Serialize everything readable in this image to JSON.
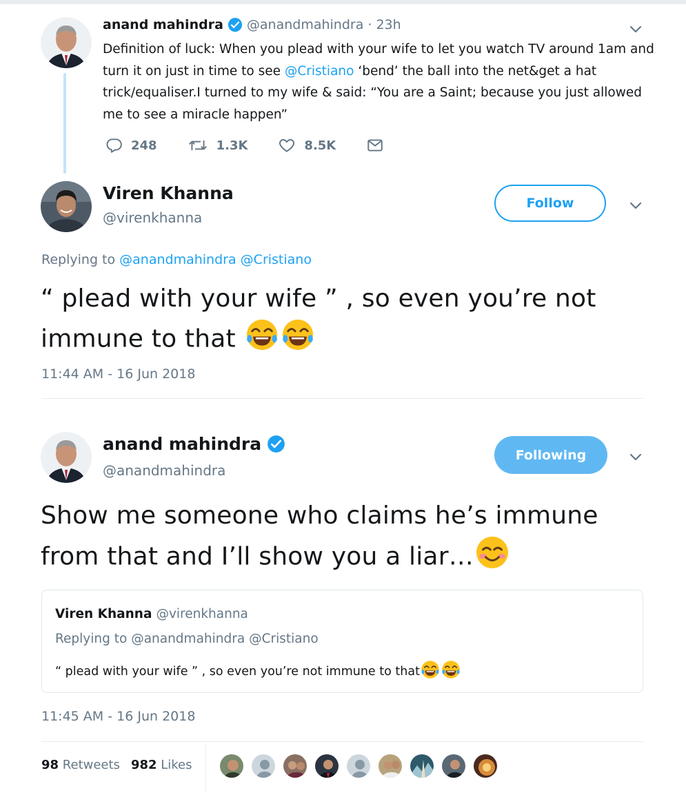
{
  "parent": {
    "name": "anand mahindra",
    "handle": "@anandmahindra",
    "time": "· 23h",
    "text_before": "Definition of luck: When you plead with your wife to let you watch TV around 1am and turn it on just in time to see ",
    "mention": "@Cristiano",
    "text_after": " ‘bend’ the ball into the net&get a hat trick/equaliser.I turned to my wife & said: “You are a Saint; because you just allowed me to see a miracle happen”",
    "replies": "248",
    "retweets": "1.3K",
    "likes": "8.5K"
  },
  "reply": {
    "name": "Viren Khanna",
    "handle": "@virenkhanna",
    "follow_label": "Follow",
    "replying_prefix": "Replying to ",
    "replying_to": [
      "@anandmahindra",
      "@Cristiano"
    ],
    "text": "“ plead with your wife ” , so even you’re not immune to that ",
    "timestamp": "11:44 AM - 16 Jun 2018"
  },
  "main": {
    "name": "anand mahindra",
    "handle": "@anandmahindra",
    "following_label": "Following",
    "text": "Show me someone who claims he’s immune from that and I’ll show you a liar…",
    "timestamp": "11:45 AM - 16 Jun 2018",
    "quote": {
      "name": "Viren Khanna",
      "handle": "@virenkhanna",
      "replying_prefix": "Replying to ",
      "replying_to": [
        "@anandmahindra",
        "@Cristiano"
      ],
      "text": "“ plead with your wife ” , so even you’re not immune to that "
    },
    "retweets_count": "98",
    "retweets_label": "Retweets",
    "likes_count": "982",
    "likes_label": "Likes"
  },
  "icons": {
    "reply": "reply-icon",
    "retweet": "retweet-icon",
    "like": "heart-icon",
    "dm": "envelope-icon",
    "verified": "verified-badge-icon",
    "caret": "chevron-down-icon"
  },
  "colors": {
    "accent": "#1da1f2",
    "following_bg": "#60b8f2",
    "muted": "#657786",
    "text": "#14171a"
  }
}
